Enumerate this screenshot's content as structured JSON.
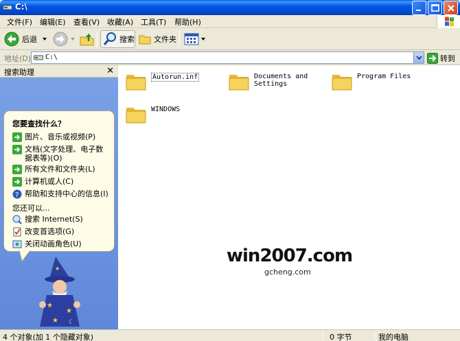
{
  "window": {
    "title": "C:\\"
  },
  "menu": [
    "文件(F)",
    "编辑(E)",
    "查看(V)",
    "收藏(A)",
    "工具(T)",
    "帮助(H)"
  ],
  "toolbar": {
    "back_label": "后退",
    "search_label": "搜索",
    "folders_label": "文件夹"
  },
  "address": {
    "label": "地址(D)",
    "value": "C:\\",
    "go_label": "转到"
  },
  "search_pane": {
    "title": "搜索助理",
    "question": "您要查找什么？",
    "options": [
      "图片、音乐或视频(P)",
      "文档(文字处理、电子数据表等)(O)",
      "所有文件和文件夹(L)",
      "计算机或人(C)",
      "帮助和支持中心的信息(I)"
    ],
    "also_label": "您还可以...",
    "more_options": [
      "搜索 Internet(S)",
      "改变首选项(G)",
      "关闭动画角色(U)"
    ]
  },
  "files": [
    {
      "name": "Autorun.inf"
    },
    {
      "name": "Documents and Settings"
    },
    {
      "name": "Program Files"
    },
    {
      "name": "WINDOWS"
    }
  ],
  "status": {
    "objects": "4 个对象(加 1 个隐藏对象)",
    "size": "0 字节",
    "location": "我的电脑"
  },
  "watermark": {
    "main": "win2007.com",
    "sub": "gcheng.com"
  },
  "colors": {
    "accent": "#0054e3",
    "pane": "#6b93e0",
    "folder": "#f6d35a"
  }
}
